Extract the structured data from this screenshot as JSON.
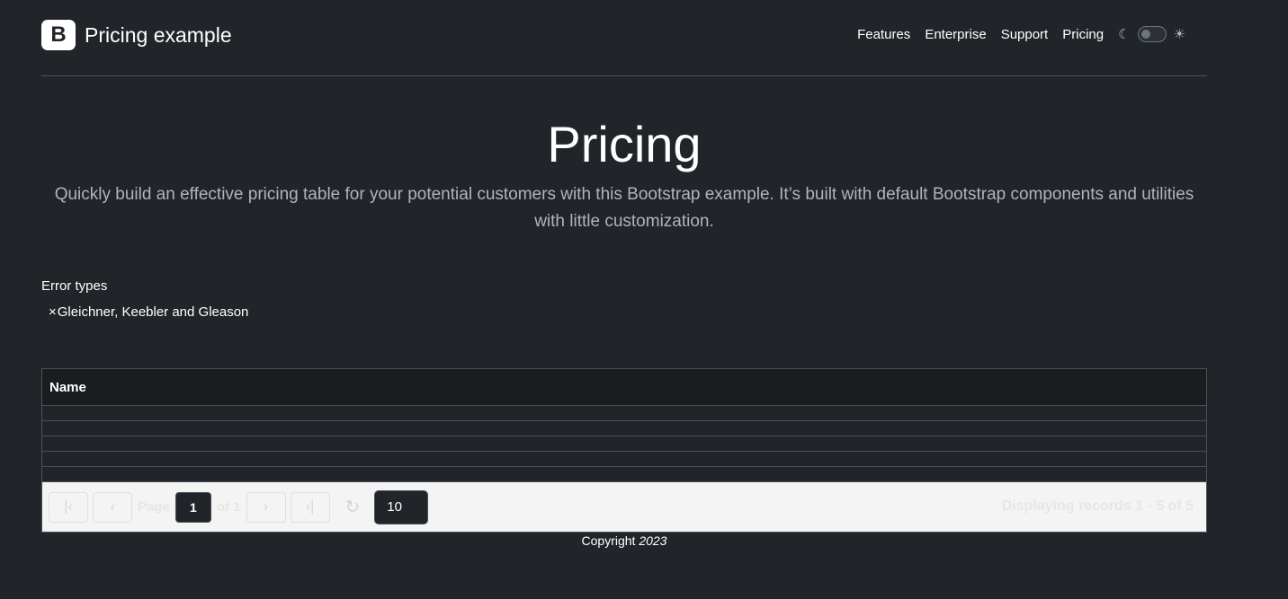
{
  "brand": {
    "logo_letter": "B",
    "title": "Pricing example"
  },
  "nav": {
    "items": [
      "Features",
      "Enterprise",
      "Support",
      "Pricing"
    ]
  },
  "theme_toggle": {
    "moon_icon": "moon-icon",
    "sun_icon": "sun-icon",
    "enabled": false
  },
  "hero": {
    "title": "Pricing",
    "description": "Quickly build an effective pricing table for your potential customers with this Bootstrap example. It’s built with default Bootstrap components and utilities with little customization."
  },
  "filter": {
    "label": "Error types",
    "chips": [
      {
        "remove": "×",
        "label": "Gleichner, Keebler and Gleason"
      }
    ]
  },
  "table": {
    "columns": [
      "Name"
    ],
    "rows": [
      "",
      "",
      "",
      "",
      ""
    ],
    "pager": {
      "first_icon": "first-page-icon",
      "prev_icon": "prev-page-icon",
      "next_icon": "next-page-icon",
      "last_icon": "last-page-icon",
      "refresh_icon": "refresh-icon",
      "page_label": "Page",
      "page_value": "1",
      "of_label": "of 1",
      "page_size": "10",
      "records_text": "Displaying records  1 - 5 of 5"
    }
  },
  "footer": {
    "copyright_label": "Copyright",
    "year": "2023"
  },
  "colors": {
    "background": "#212529",
    "text": "#dee2e6",
    "muted": "#adb5bd",
    "border": "#495057",
    "pager_bg": "#f4f4f4"
  }
}
